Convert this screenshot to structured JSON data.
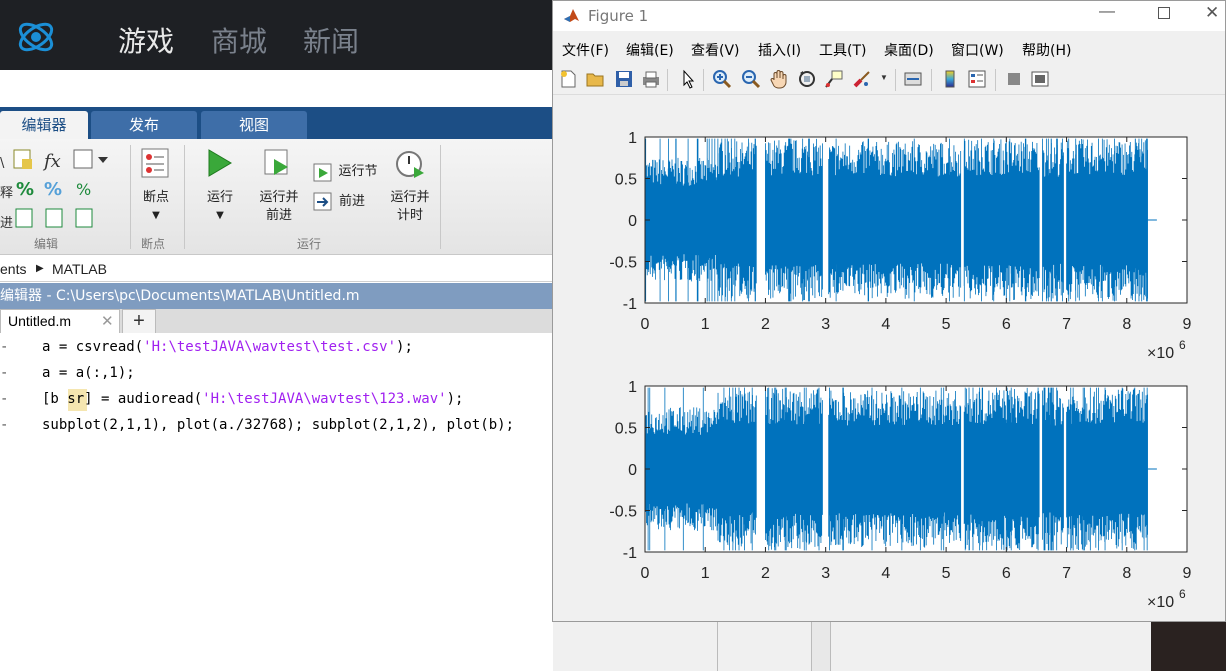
{
  "background_app": {
    "nav": [
      "游戏",
      "商城",
      "新闻"
    ],
    "ribbon_tabs": [
      "编辑器",
      "发布",
      "视图"
    ],
    "ribbon": {
      "breakpoints_label": "断点",
      "run_label": "运行",
      "run_advance_label": "运行并\n前进",
      "run_section_label": "运行节",
      "advance_label": "前进",
      "run_time_label": "运行并\n计时",
      "section_edit": "编辑",
      "section_breakpoints": "断点",
      "section_run": "运行"
    },
    "breadcrumb": [
      "ents",
      "MATLAB"
    ],
    "editor_title": "编辑器 - C:\\Users\\pc\\Documents\\MATLAB\\Untitled.m",
    "editor_tab": "Untitled.m",
    "code_lines": [
      {
        "pre": "a = csvread(",
        "str": "'H:\\testJAVA\\wavtest\\test.csv'",
        "post": ");"
      },
      {
        "pre": "a = a(:,1);",
        "str": "",
        "post": ""
      },
      {
        "pre": "[b sr] = audioread(",
        "str": "'H:\\testJAVA\\wavtest\\123.wav'",
        "post": ");"
      },
      {
        "pre": "subplot(2,1,1), plot(a./32768); subplot(2,1,2), plot(b);",
        "str": "",
        "post": ""
      }
    ]
  },
  "figure": {
    "title": "Figure 1",
    "menu": [
      "文件(F)",
      "编辑(E)",
      "查看(V)",
      "插入(I)",
      "工具(T)",
      "桌面(D)",
      "窗口(W)",
      "帮助(H)"
    ],
    "toolbar_icons": [
      "new-figure-icon",
      "open-file-icon",
      "save-icon",
      "print-icon",
      "pointer-icon",
      "zoom-in-icon",
      "zoom-out-icon",
      "pan-icon",
      "rotate-3d-icon",
      "data-cursor-icon",
      "brush-icon",
      "link-plot-icon",
      "colorbar-icon",
      "legend-icon",
      "hide-plot-tools-icon",
      "show-plot-tools-icon"
    ],
    "exponent": "×10",
    "exponent_power": "6"
  },
  "chart_data": [
    {
      "type": "line",
      "description_color": "#0072bd",
      "x_ticks": [
        0,
        1,
        2,
        3,
        4,
        5,
        6,
        7,
        8,
        9
      ],
      "y_ticks": [
        1,
        0.5,
        0,
        -0.5,
        -1
      ],
      "x_tick_labels": [
        "0",
        "1",
        "2",
        "3",
        "4",
        "5",
        "6",
        "7",
        "8",
        "9"
      ],
      "y_tick_labels": [
        "1",
        "0.5",
        "0",
        "-0.5",
        "-1"
      ],
      "xlim": [
        0,
        9000000
      ],
      "ylim": [
        -1,
        1
      ],
      "x_multiplier": "×10^6",
      "signal_segments": [
        {
          "start": 0.0,
          "end": 1.2,
          "amp": 0.75
        },
        {
          "start": 1.2,
          "end": 1.85,
          "amp": 0.95
        },
        {
          "start": 2.0,
          "end": 2.95,
          "amp": 0.98
        },
        {
          "start": 3.05,
          "end": 5.25,
          "amp": 0.95
        },
        {
          "start": 5.3,
          "end": 6.55,
          "amp": 0.98
        },
        {
          "start": 6.6,
          "end": 6.95,
          "amp": 0.95
        },
        {
          "start": 7.0,
          "end": 8.35,
          "amp": 0.98
        }
      ],
      "signal_end": 8.5
    },
    {
      "type": "line",
      "description_color": "#0072bd",
      "x_ticks": [
        0,
        1,
        2,
        3,
        4,
        5,
        6,
        7,
        8,
        9
      ],
      "y_ticks": [
        1,
        0.5,
        0,
        -0.5,
        -1
      ],
      "x_tick_labels": [
        "0",
        "1",
        "2",
        "3",
        "4",
        "5",
        "6",
        "7",
        "8",
        "9"
      ],
      "y_tick_labels": [
        "1",
        "0.5",
        "0",
        "-0.5",
        "-1"
      ],
      "xlim": [
        0,
        9000000
      ],
      "ylim": [
        -1,
        1
      ],
      "x_multiplier": "×10^6",
      "signal_segments": [
        {
          "start": 0.0,
          "end": 1.2,
          "amp": 0.75
        },
        {
          "start": 1.2,
          "end": 1.85,
          "amp": 0.95
        },
        {
          "start": 2.0,
          "end": 2.95,
          "amp": 0.98
        },
        {
          "start": 3.05,
          "end": 5.25,
          "amp": 0.95
        },
        {
          "start": 5.3,
          "end": 6.55,
          "amp": 0.98
        },
        {
          "start": 6.6,
          "end": 6.95,
          "amp": 0.95
        },
        {
          "start": 7.0,
          "end": 8.35,
          "amp": 0.98
        }
      ],
      "signal_end": 8.5
    }
  ]
}
